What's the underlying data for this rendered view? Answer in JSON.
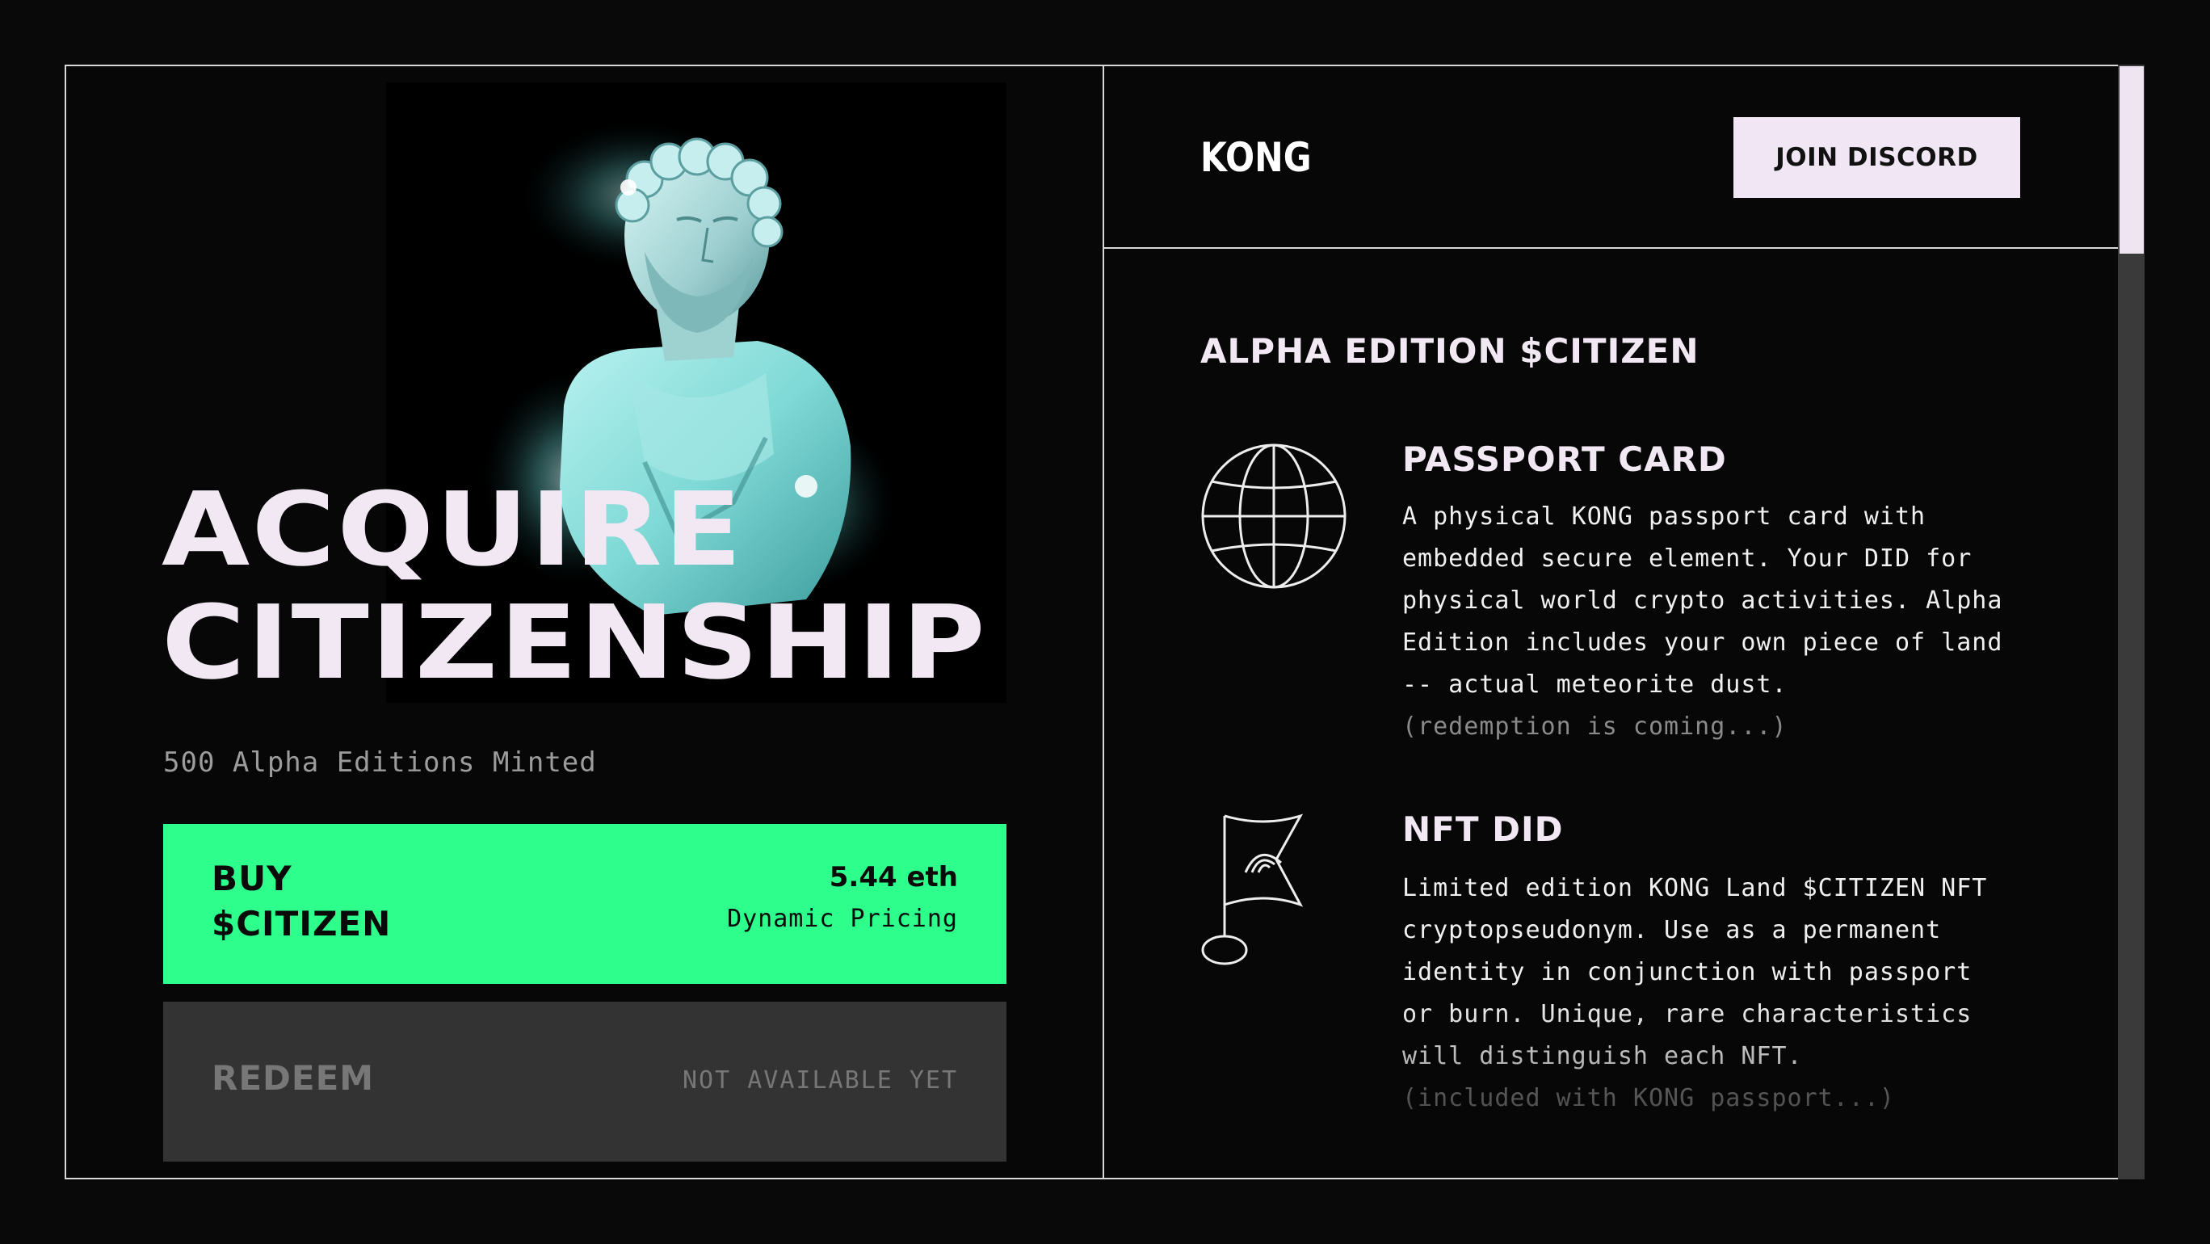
{
  "hero": {
    "headline_line1": "ACQUIRE",
    "headline_line2": "CITIZENSHIP",
    "minted_text": "500 Alpha Editions Minted"
  },
  "buy": {
    "label_line1": "BUY",
    "label_line2": "$CITIZEN",
    "price": "5.44 eth",
    "pricing_note": "Dynamic Pricing"
  },
  "redeem": {
    "label": "REDEEM",
    "status": "NOT AVAILABLE YET"
  },
  "header": {
    "logo": "KONG",
    "discord_label": "JOIN DISCORD"
  },
  "section": {
    "title": "ALPHA EDITION $CITIZEN"
  },
  "features": [
    {
      "icon": "globe-icon",
      "title": "PASSPORT CARD",
      "lines": [
        "A physical KONG passport card with",
        "embedded secure element. Your DID for",
        "physical world crypto activities. Alpha",
        "Edition includes your own piece of land",
        "-- actual meteorite dust."
      ],
      "note": "(redemption is coming...)"
    },
    {
      "icon": "flag-icon",
      "title": "NFT DID",
      "lines": [
        "Limited edition KONG Land $CITIZEN NFT",
        "cryptopseudonym. Use as a permanent",
        "identity in conjunction with passport",
        "or burn. Unique, rare characteristics",
        "will distinguish each NFT."
      ],
      "note": "(included with KONG passport...)"
    }
  ],
  "colors": {
    "accent_green": "#2dfe8c",
    "text_light": "#f2e8f4",
    "button_disabled": "#333333"
  }
}
